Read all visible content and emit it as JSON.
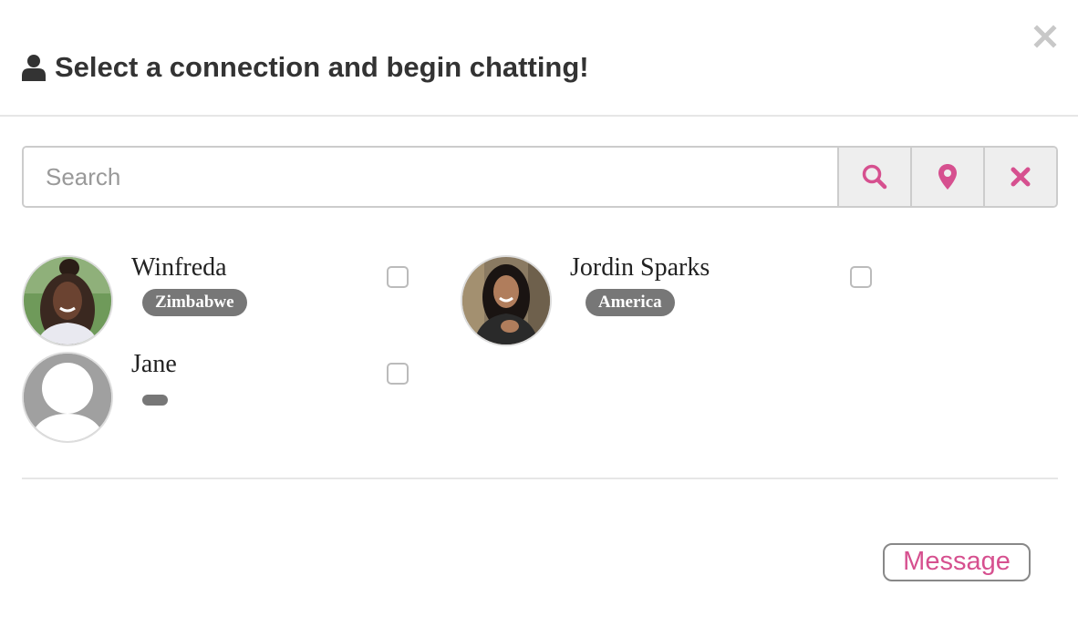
{
  "header": {
    "title": "Select a connection and begin chatting!",
    "title_icon": "user-icon",
    "close_icon": "close-icon"
  },
  "search": {
    "placeholder": "Search",
    "value": "",
    "buttons": [
      {
        "icon": "search-icon"
      },
      {
        "icon": "map-marker-icon"
      },
      {
        "icon": "clear-icon"
      }
    ]
  },
  "contacts": [
    {
      "name": "Winfreda",
      "location": "Zimbabwe",
      "checked": false
    },
    {
      "name": "Jordin Sparks",
      "location": "America",
      "checked": false
    },
    {
      "name": "Jane",
      "location": "",
      "checked": false
    }
  ],
  "footer": {
    "message_label": "Message"
  },
  "colors": {
    "accent": "#d6508f",
    "title": "#333333",
    "badge": "#777777",
    "border": "#cccccc",
    "addon_bg": "#eeeeee"
  }
}
